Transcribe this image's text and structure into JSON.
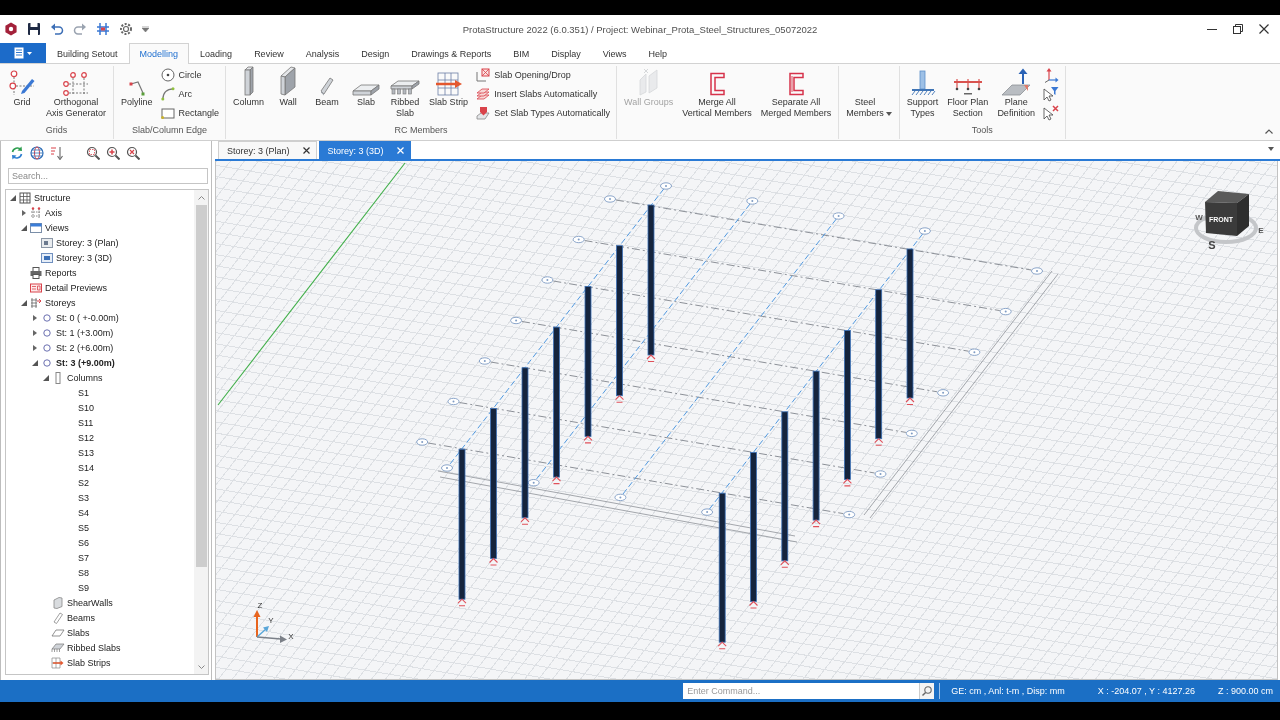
{
  "window": {
    "title": "ProtaStructure 2022 (6.0.351) / Project: Webinar_Prota_Steel_Structures_05072022"
  },
  "menu_tabs": [
    {
      "label": "Building Setout",
      "selected": false
    },
    {
      "label": "Modelling",
      "selected": true
    },
    {
      "label": "Loading",
      "selected": false
    },
    {
      "label": "Review",
      "selected": false
    },
    {
      "label": "Analysis",
      "selected": false
    },
    {
      "label": "Design",
      "selected": false
    },
    {
      "label": "Drawings & Reports",
      "selected": false
    },
    {
      "label": "BIM",
      "selected": false
    },
    {
      "label": "Display",
      "selected": false
    },
    {
      "label": "Views",
      "selected": false
    },
    {
      "label": "Help",
      "selected": false
    }
  ],
  "ribbon": {
    "groups": [
      {
        "label": "Grids",
        "buttons": [
          {
            "kind": "grid",
            "label": "Grid",
            "disabled": false
          },
          {
            "kind": "axis-generator",
            "label": "Orthogonal\nAxis Generator",
            "disabled": false
          }
        ]
      },
      {
        "label": "Slab/Column Edge",
        "buttons": [
          {
            "kind": "polyline",
            "label": "Polyline",
            "disabled": false
          }
        ],
        "small_buttons": [
          {
            "kind": "circle",
            "label": "Circle",
            "disabled": false
          },
          {
            "kind": "arc",
            "label": "Arc",
            "disabled": false
          },
          {
            "kind": "rectangle",
            "label": "Rectangle",
            "disabled": false
          }
        ]
      },
      {
        "label": "RC Members",
        "buttons": [
          {
            "kind": "column",
            "label": "Column",
            "disabled": false
          },
          {
            "kind": "wall",
            "label": "Wall",
            "disabled": false
          },
          {
            "kind": "beam",
            "label": "Beam",
            "disabled": false
          },
          {
            "kind": "slab",
            "label": "Slab",
            "disabled": false
          },
          {
            "kind": "ribbed-slab",
            "label": "Ribbed\nSlab",
            "disabled": false
          },
          {
            "kind": "slab-strip",
            "label": "Slab Strip",
            "disabled": false
          }
        ],
        "small_buttons": [
          {
            "kind": "slab-opening",
            "label": "Slab Opening/Drop",
            "disabled": false
          },
          {
            "kind": "insert-slabs",
            "label": "Insert Slabs Automatically",
            "disabled": false
          },
          {
            "kind": "slab-types",
            "label": "Set Slab Types Automatically",
            "disabled": false
          }
        ]
      },
      {
        "buttons": [
          {
            "kind": "wall-groups",
            "label": "Wall Groups",
            "disabled": true
          },
          {
            "kind": "merge",
            "label": "Merge All\nVertical Members",
            "disabled": false
          },
          {
            "kind": "separate",
            "label": "Separate All\nMerged Members",
            "disabled": false
          }
        ]
      },
      {
        "buttons": [
          {
            "kind": "steel-members",
            "label": "Steel\nMembers",
            "disabled": false
          }
        ]
      },
      {
        "label": "Tools",
        "buttons": [
          {
            "kind": "support",
            "label": "Support\nTypes",
            "disabled": false
          },
          {
            "kind": "section",
            "label": "Floor Plan\nSection",
            "disabled": false
          },
          {
            "kind": "plane",
            "label": "Plane\nDefinition",
            "disabled": false
          }
        ],
        "icon_buttons": [
          {
            "kind": "local-axes",
            "disabled": false
          },
          {
            "kind": "filter-select",
            "disabled": false
          },
          {
            "kind": "clear-select",
            "disabled": false
          }
        ]
      }
    ]
  },
  "document_tabs": [
    {
      "label": "Storey: 3 (Plan)",
      "selected": false
    },
    {
      "label": "Storey: 3 (3D)",
      "selected": true
    }
  ],
  "explorer": {
    "search": {
      "placeholder": "Search..."
    },
    "tree": [
      {
        "kind": "structure",
        "label": "Structure",
        "expanded": true,
        "children": [
          {
            "kind": "axis",
            "label": "Axis",
            "expanded": false
          },
          {
            "kind": "views",
            "label": "Views",
            "expanded": true,
            "children": [
              {
                "kind": "plan",
                "label": "Storey: 3 (Plan)"
              },
              {
                "kind": "perspective",
                "label": "Storey: 3 (3D)"
              }
            ]
          },
          {
            "kind": "reports",
            "label": "Reports"
          },
          {
            "kind": "previews",
            "label": "Detail Previews"
          },
          {
            "kind": "storeys",
            "label": "Storeys",
            "expanded": true,
            "children": [
              {
                "kind": "storey",
                "label": "St: 0 ( +-0.00m)",
                "expanded": false,
                "active": false
              },
              {
                "kind": "storey",
                "label": "St: 1 (+3.00m)",
                "expanded": false,
                "active": false
              },
              {
                "kind": "storey",
                "label": "St: 2 (+6.00m)",
                "expanded": false,
                "active": false
              },
              {
                "kind": "storey",
                "label": "St: 3 (+9.00m)",
                "expanded": true,
                "active": true,
                "children": [
                  {
                    "kind": "columns",
                    "label": "Columns",
                    "expanded": true,
                    "children": [
                      {
                        "label": "S1"
                      },
                      {
                        "label": "S10"
                      },
                      {
                        "label": "S11"
                      },
                      {
                        "label": "S12"
                      },
                      {
                        "label": "S13"
                      },
                      {
                        "label": "S14"
                      },
                      {
                        "label": "S2"
                      },
                      {
                        "label": "S3"
                      },
                      {
                        "label": "S4"
                      },
                      {
                        "label": "S5"
                      },
                      {
                        "label": "S6"
                      },
                      {
                        "label": "S7"
                      },
                      {
                        "label": "S8"
                      },
                      {
                        "label": "S9"
                      }
                    ]
                  },
                  {
                    "kind": "shear-walls",
                    "label": "ShearWalls"
                  },
                  {
                    "kind": "beams",
                    "label": "Beams"
                  },
                  {
                    "kind": "slabs",
                    "label": "Slabs"
                  },
                  {
                    "kind": "ribbed-slabs",
                    "label": "Ribbed Slabs"
                  },
                  {
                    "kind": "slab-strips",
                    "label": "Slab Strips"
                  }
                ]
              }
            ]
          }
        ]
      }
    ]
  },
  "viewport": {
    "view_cube": {
      "west": "W",
      "face": "FRONT",
      "east": "E",
      "south": "S"
    },
    "axis_triad": {
      "z": "Z",
      "y": "Y",
      "x": "X"
    }
  },
  "status_bar": {
    "command": {
      "placeholder": "Enter Command..."
    },
    "units": "GE: cm , Anl: t-m , Disp: mm",
    "cursor_xy": "X : -204.07 , Y : 4127.26",
    "cursor_z": "Z : 900.00 cm"
  }
}
